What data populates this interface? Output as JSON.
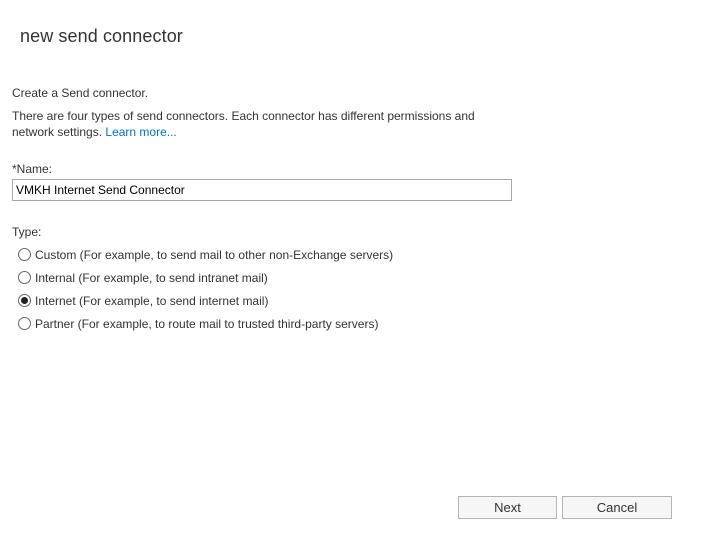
{
  "dialog": {
    "title": "new send connector",
    "intro": "Create a Send connector.",
    "description": "There are four types of send connectors. Each connector has different permissions and network settings.",
    "learn_more": "Learn more..."
  },
  "name_field": {
    "label": "*Name:",
    "value": "VMKH Internet Send Connector"
  },
  "type": {
    "label": "Type:",
    "selected_index": 2,
    "options": [
      {
        "label": "Custom (For example, to send mail to other non-Exchange servers)",
        "checked": false
      },
      {
        "label": "Internal (For example, to send intranet mail)",
        "checked": false
      },
      {
        "label": "Internet (For example, to send internet mail)",
        "checked": true
      },
      {
        "label": "Partner (For example, to route mail to trusted third-party servers)",
        "checked": false
      }
    ]
  },
  "buttons": {
    "next": "Next",
    "cancel": "Cancel"
  }
}
